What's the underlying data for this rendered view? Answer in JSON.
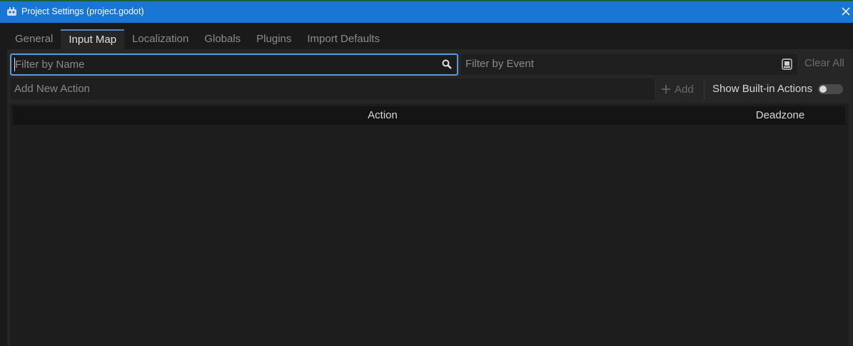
{
  "window": {
    "title": "Project Settings (project.godot)",
    "accent_color": "#1976d4",
    "app_icon": "godot-icon",
    "close_icon": "close-icon"
  },
  "tabs": [
    {
      "label": "General",
      "active": false
    },
    {
      "label": "Input Map",
      "active": true
    },
    {
      "label": "Localization",
      "active": false
    },
    {
      "label": "Globals",
      "active": false
    },
    {
      "label": "Plugins",
      "active": false
    },
    {
      "label": "Import Defaults",
      "active": false
    }
  ],
  "input_map": {
    "filter_name": {
      "placeholder": "Filter by Name",
      "value": "",
      "icon": "search-icon"
    },
    "filter_event": {
      "placeholder": "Filter by Event",
      "value": "",
      "icon": "keyboard-icon"
    },
    "clear_all_label": "Clear All",
    "add_action": {
      "placeholder": "Add New Action",
      "value": ""
    },
    "add_button_label": "Add",
    "add_icon": "plus-icon",
    "show_builtin_label": "Show Built-in Actions",
    "show_builtin_enabled": false,
    "columns": {
      "action": "Action",
      "deadzone": "Deadzone"
    },
    "rows": []
  }
}
